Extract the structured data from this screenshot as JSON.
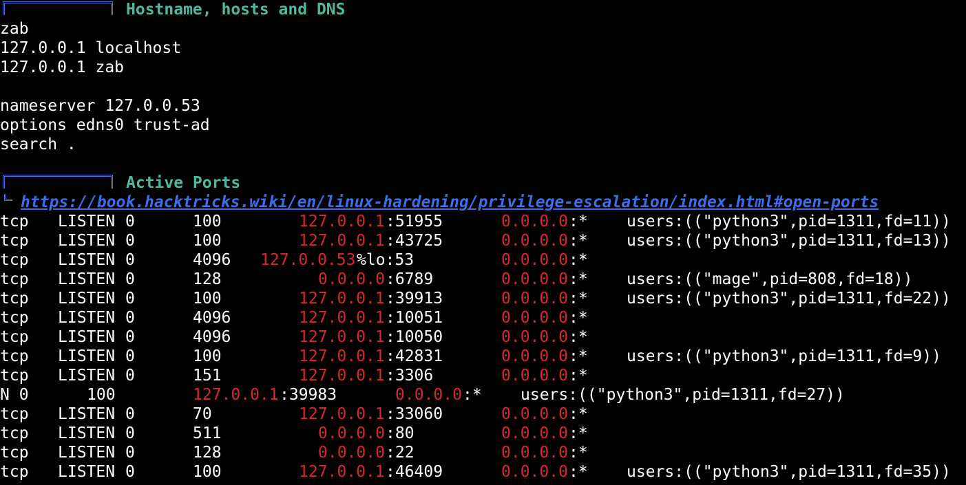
{
  "section_hosts": {
    "title": "Hostname, hosts and DNS",
    "lines": [
      "zab",
      "127.0.0.1 localhost",
      "127.0.0.1 zab",
      "",
      "nameserver 127.0.0.53",
      "options edns0 trust-ad",
      "search ."
    ]
  },
  "section_ports": {
    "title": "Active Ports",
    "link": "https://book.hacktricks.wiki/en/linux-hardening/privilege-escalation/index.html#open-ports",
    "rows": [
      {
        "proto": "tcp",
        "state": "LISTEN",
        "recvq": "0",
        "sendq": "100",
        "local_ip": "127.0.0.1",
        "local_port": ":51955",
        "peer_ip": "0.0.0.0",
        "peer_port": ":*",
        "process": "users:((\"python3\",pid=1311,fd=11))"
      },
      {
        "proto": "tcp",
        "state": "LISTEN",
        "recvq": "0",
        "sendq": "100",
        "local_ip": "127.0.0.1",
        "local_port": ":43725",
        "peer_ip": "0.0.0.0",
        "peer_port": ":*",
        "process": "users:((\"python3\",pid=1311,fd=13))"
      },
      {
        "proto": "tcp",
        "state": "LISTEN",
        "recvq": "0",
        "sendq": "4096",
        "local_ip": "127.0.0.53",
        "local_port": "%lo:53",
        "peer_ip": "0.0.0.0",
        "peer_port": ":*",
        "process": ""
      },
      {
        "proto": "tcp",
        "state": "LISTEN",
        "recvq": "0",
        "sendq": "128",
        "local_ip": "0.0.0.0",
        "local_port": ":6789",
        "peer_ip": "0.0.0.0",
        "peer_port": ":*",
        "process": "users:((\"mage\",pid=808,fd=18))"
      },
      {
        "proto": "tcp",
        "state": "LISTEN",
        "recvq": "0",
        "sendq": "100",
        "local_ip": "127.0.0.1",
        "local_port": ":39913",
        "peer_ip": "0.0.0.0",
        "peer_port": ":*",
        "process": "users:((\"python3\",pid=1311,fd=22))"
      },
      {
        "proto": "tcp",
        "state": "LISTEN",
        "recvq": "0",
        "sendq": "4096",
        "local_ip": "127.0.0.1",
        "local_port": ":10051",
        "peer_ip": "0.0.0.0",
        "peer_port": ":*",
        "process": ""
      },
      {
        "proto": "tcp",
        "state": "LISTEN",
        "recvq": "0",
        "sendq": "4096",
        "local_ip": "127.0.0.1",
        "local_port": ":10050",
        "peer_ip": "0.0.0.0",
        "peer_port": ":*",
        "process": ""
      },
      {
        "proto": "tcp",
        "state": "LISTEN",
        "recvq": "0",
        "sendq": "100",
        "local_ip": "127.0.0.1",
        "local_port": ":42831",
        "peer_ip": "0.0.0.0",
        "peer_port": ":*",
        "process": "users:((\"python3\",pid=1311,fd=9))"
      },
      {
        "proto": "tcp",
        "state": "LISTEN",
        "recvq": "0",
        "sendq": "151",
        "local_ip": "127.0.0.1",
        "local_port": ":3306",
        "peer_ip": "0.0.0.0",
        "peer_port": ":*",
        "process": ""
      },
      {
        "broken": true,
        "prefix": "N 0",
        "sendq": "100",
        "local_ip": "127.0.0.1",
        "local_port": ":39983",
        "peer_ip": "0.0.0.0",
        "peer_port": ":*",
        "process": "users:((\"python3\",pid=1311,fd=27))"
      },
      {
        "proto": "tcp",
        "state": "LISTEN",
        "recvq": "0",
        "sendq": "70",
        "local_ip": "127.0.0.1",
        "local_port": ":33060",
        "peer_ip": "0.0.0.0",
        "peer_port": ":*",
        "process": ""
      },
      {
        "proto": "tcp",
        "state": "LISTEN",
        "recvq": "0",
        "sendq": "511",
        "local_ip": "0.0.0.0",
        "local_port": ":80",
        "peer_ip": "0.0.0.0",
        "peer_port": ":*",
        "process": ""
      },
      {
        "proto": "tcp",
        "state": "LISTEN",
        "recvq": "0",
        "sendq": "128",
        "local_ip": "0.0.0.0",
        "local_port": ":22",
        "peer_ip": "0.0.0.0",
        "peer_port": ":*",
        "process": ""
      },
      {
        "proto": "tcp",
        "state": "LISTEN",
        "recvq": "0",
        "sendq": "100",
        "local_ip": "127.0.0.1",
        "local_port": ":46409",
        "peer_ip": "0.0.0.0",
        "peer_port": ":*",
        "process": "users:((\"python3\",pid=1311,fd=35))"
      }
    ]
  },
  "colors": {
    "background": "#000000",
    "text": "#ffffff",
    "header_title": "#4fb89e",
    "header_box": "#4a6fd8",
    "link": "#3c6ee8",
    "ip_highlight": "#d9262a"
  }
}
